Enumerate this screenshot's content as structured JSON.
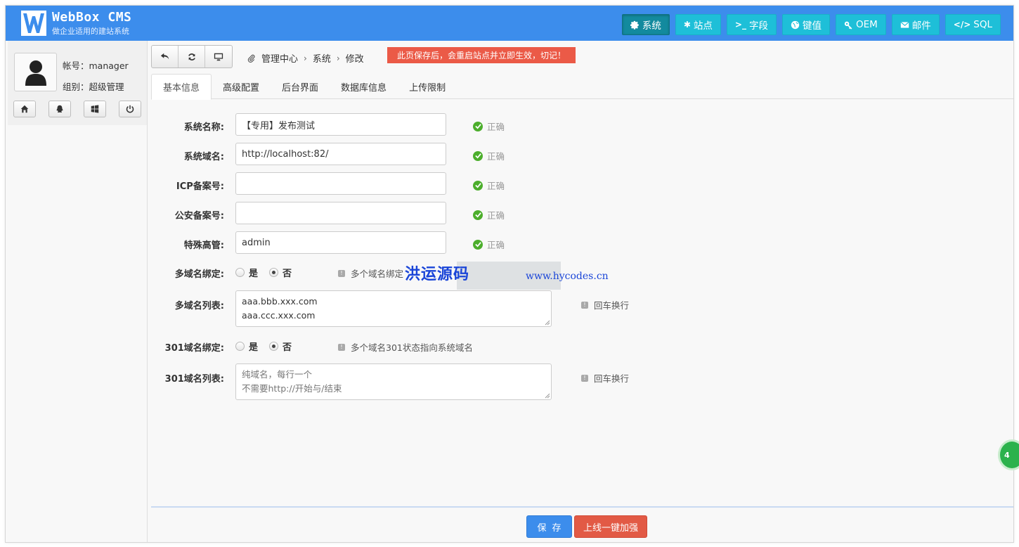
{
  "header": {
    "brand_title": "WebBox CMS",
    "brand_subtitle": "做企业适用的建站系统",
    "nav": [
      {
        "label": "系统",
        "icon": "gear-icon",
        "active": true
      },
      {
        "label": "站点",
        "icon": "asterisk-icon",
        "active": false
      },
      {
        "label": "字段",
        "icon": "terminal-icon",
        "active": false
      },
      {
        "label": "键值",
        "icon": "globe-icon",
        "active": false
      },
      {
        "label": "OEM",
        "icon": "key-icon",
        "active": false
      },
      {
        "label": "邮件",
        "icon": "envelope-icon",
        "active": false
      },
      {
        "label": "SQL",
        "icon": "code-icon",
        "active": false
      }
    ]
  },
  "sidebar": {
    "account_label": "帐号：manager",
    "group_label": "组别：超级管理",
    "quick_icons": [
      "home-icon",
      "qq-icon",
      "windows-icon",
      "power-icon"
    ]
  },
  "toolbar": {
    "icons": [
      "undo-icon",
      "refresh-icon",
      "monitor-icon"
    ]
  },
  "breadcrumb": {
    "items": [
      "管理中心",
      "系统",
      "修改"
    ]
  },
  "warning_text": "此页保存后，会重启站点并立即生效，切记！",
  "tabs": [
    "基本信息",
    "高级配置",
    "后台界面",
    "数据库信息",
    "上传限制"
  ],
  "form": {
    "ok_text": "正确",
    "fields": [
      {
        "label": "系统名称:",
        "value": "【专用】发布测试"
      },
      {
        "label": "系统域名:",
        "value": "http://localhost:82/"
      },
      {
        "label": "ICP备案号:",
        "value": ""
      },
      {
        "label": "公安备案号:",
        "value": ""
      },
      {
        "label": "特殊高管:",
        "value": "admin"
      }
    ],
    "multi_bind": {
      "label": "多域名绑定:",
      "yes": "是",
      "no": "否",
      "selected": "否",
      "hint": "多个域名绑定"
    },
    "multi_list": {
      "label": "多域名列表:",
      "lines": [
        "aaa.bbb.xxx.com",
        "aaa.ccc.xxx.com"
      ],
      "hint": "回车换行"
    },
    "redirect_bind": {
      "label": "301域名绑定:",
      "yes": "是",
      "no": "否",
      "selected": "否",
      "hint": "多个域名301状态指向系统域名"
    },
    "redirect_list": {
      "label": "301域名列表:",
      "placeholder_lines": [
        "纯域名，每行一个",
        "不需要http://开始与/结束"
      ],
      "hint": "回车换行"
    }
  },
  "watermark": {
    "cn": "洪运源码",
    "url": "www.hycodes.cn"
  },
  "buttons": {
    "save": "保存",
    "online": "上线一键加强"
  },
  "float_badge": "4"
}
